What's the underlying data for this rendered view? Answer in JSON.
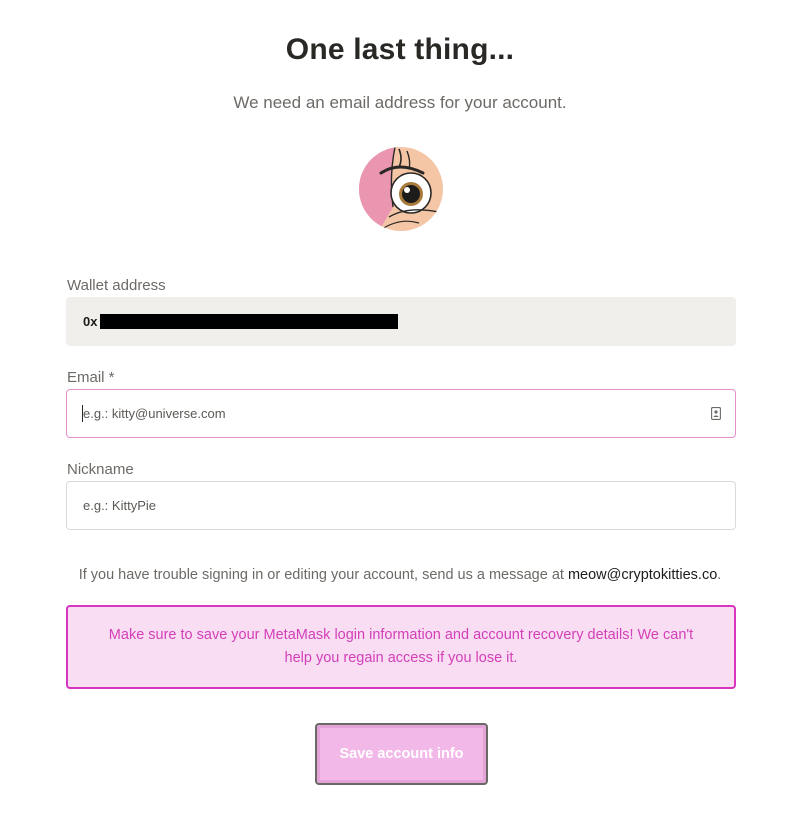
{
  "header": {
    "title": "One last thing...",
    "subtitle": "We need an email address for your account."
  },
  "form": {
    "wallet": {
      "label": "Wallet address",
      "value_prefix": "0x"
    },
    "email": {
      "label": "Email *",
      "placeholder": "e.g.: kitty@universe.com",
      "value": ""
    },
    "nickname": {
      "label": "Nickname",
      "placeholder": "e.g.: KittyPie",
      "value": ""
    }
  },
  "help": {
    "text": "If you have trouble signing in or editing your account, send us a message at ",
    "email": "meow@cryptokitties.co",
    "suffix": "."
  },
  "warning": {
    "text": "Make sure to save your MetaMask login information and account recovery details! We can't help you regain access if you lose it."
  },
  "actions": {
    "save_label": "Save account info"
  },
  "colors": {
    "accent": "#d735c0",
    "warning_bg": "#f8ddf3",
    "button_bg": "#f2b8e8"
  }
}
